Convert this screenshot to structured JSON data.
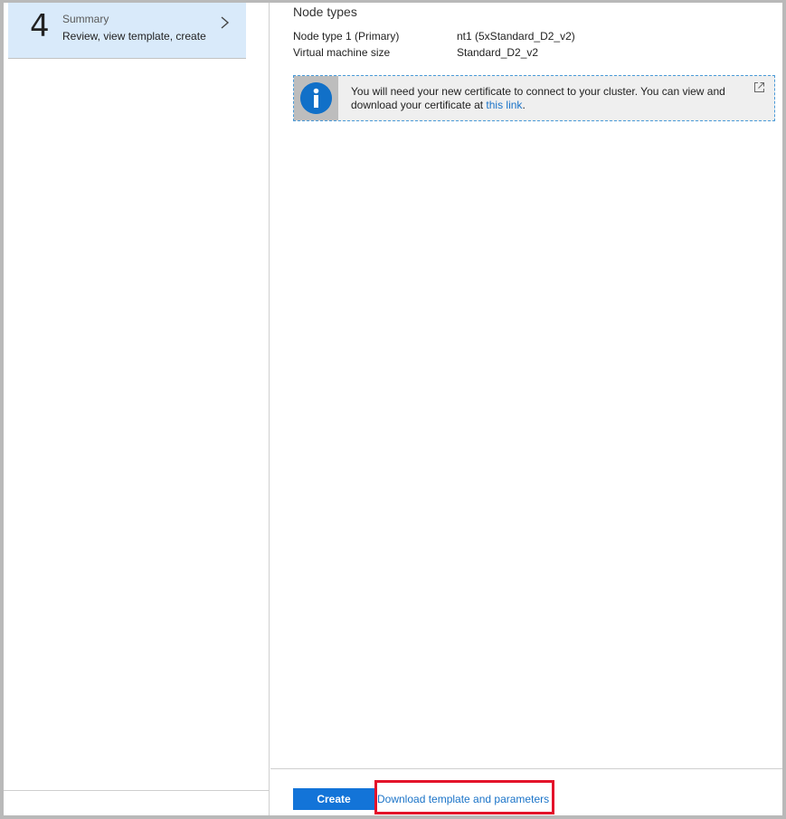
{
  "steps": {
    "current": {
      "number": "4",
      "title": "Summary",
      "subtitle": "Review, view template, create"
    }
  },
  "summary": {
    "section_title": "Node types",
    "rows": [
      {
        "label": "Node type 1 (Primary)",
        "value": "nt1 (5xStandard_D2_v2)"
      },
      {
        "label": "Virtual machine size",
        "value": "Standard_D2_v2"
      }
    ],
    "info": {
      "text_before": "You will need your new certificate to connect to your cluster. You can view and download your certificate at ",
      "link_text": "this link",
      "text_after": ".",
      "icon": "info-icon",
      "external_icon": "external-link-icon"
    }
  },
  "footer": {
    "create_label": "Create",
    "download_label": "Download template and parameters"
  },
  "colors": {
    "accent": "#1374d8",
    "step_highlight": "#d9eafa",
    "callout_highlight": "#e3132a"
  }
}
